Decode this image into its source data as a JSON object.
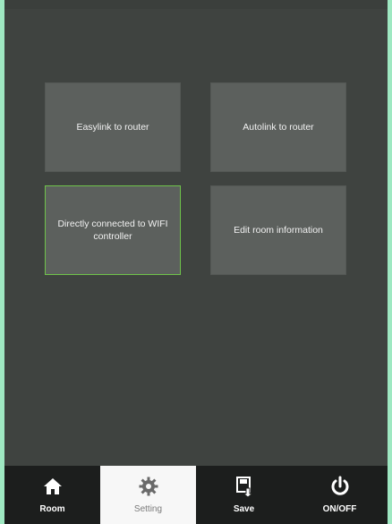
{
  "statusbar": {
    "left": "",
    "center": "",
    "right": ""
  },
  "tiles": [
    {
      "label": "Easylink to router",
      "selected": false
    },
    {
      "label": "Autolink to router",
      "selected": false
    },
    {
      "label": "Directly connected to WIFI controller",
      "selected": true
    },
    {
      "label": "Edit room information",
      "selected": false
    }
  ],
  "tabbar": {
    "active_index": 1,
    "items": [
      {
        "label": "Room",
        "icon": "home-icon"
      },
      {
        "label": "Setting",
        "icon": "gear-icon"
      },
      {
        "label": "Save",
        "icon": "save-icon"
      },
      {
        "label": "ON/OFF",
        "icon": "power-icon"
      }
    ]
  },
  "colors": {
    "background": "#3f4340",
    "tile": "#5c605d",
    "selected_border": "#6fc34a",
    "tabbar": "#1c1e1d",
    "frame": "#9fe8c2"
  }
}
